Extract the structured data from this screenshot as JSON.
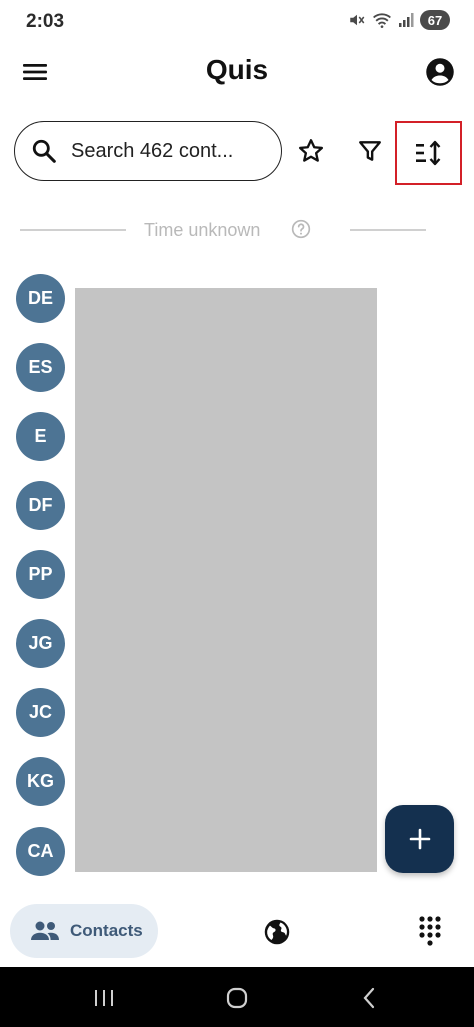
{
  "status_bar": {
    "time": "2:03",
    "battery": "67"
  },
  "app_bar": {
    "title": "Quis"
  },
  "search": {
    "text": "Search 462 cont..."
  },
  "section": {
    "label": "Time unknown"
  },
  "contacts": [
    {
      "initials": "DE"
    },
    {
      "initials": "ES"
    },
    {
      "initials": "E"
    },
    {
      "initials": "DF"
    },
    {
      "initials": "PP"
    },
    {
      "initials": "JG"
    },
    {
      "initials": "JC"
    },
    {
      "initials": "KG"
    },
    {
      "initials": "CA"
    }
  ],
  "bottom_nav": {
    "contacts_label": "Contacts"
  },
  "colors": {
    "avatar": "#4d7494",
    "fab": "#14304f",
    "nav_active_bg": "#e5ecf3",
    "highlight": "#d32028"
  },
  "icons": {
    "menu": "hamburger-menu-icon",
    "account": "account-circle-icon",
    "search": "search-icon",
    "star": "star-outline-icon",
    "filter": "filter-icon",
    "sort": "sort-icon",
    "help": "help-circle-icon",
    "add": "plus-icon",
    "contacts": "people-icon",
    "globe": "globe-icon",
    "dialpad": "dialpad-icon"
  }
}
